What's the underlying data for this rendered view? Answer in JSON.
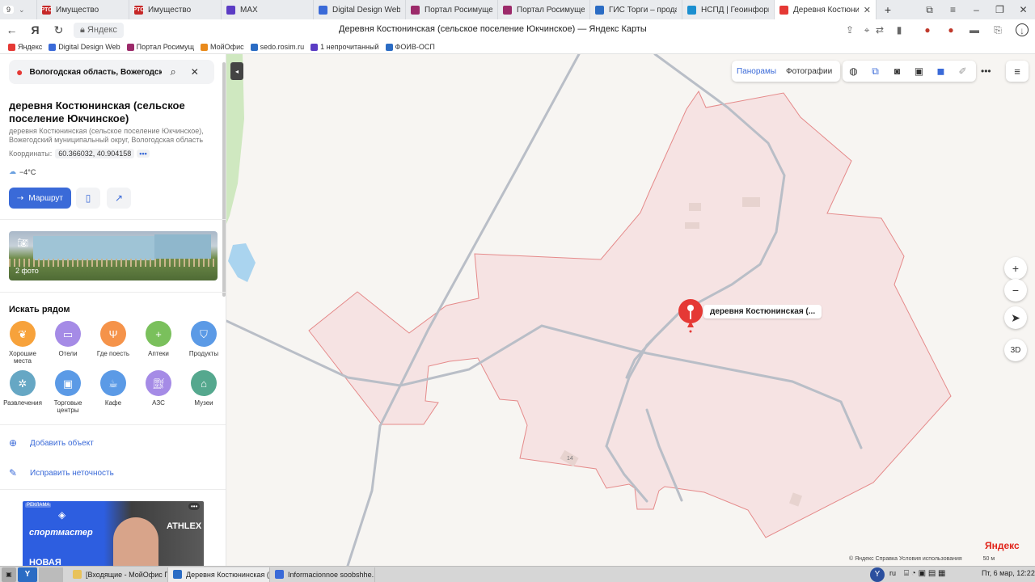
{
  "browser": {
    "tab_counter": "9",
    "tabs": [
      {
        "label": "Имущество",
        "favicon": "РТС",
        "color": "#c62828"
      },
      {
        "label": "Имущество",
        "favicon": "РТС",
        "color": "#c62828"
      },
      {
        "label": "MAX",
        "favicon": "",
        "color": "#5b3cc4"
      },
      {
        "label": "Digital Design Web C",
        "favicon": "",
        "color": "#3a6ad8"
      },
      {
        "label": "Портал Росимущест",
        "favicon": "",
        "color": "#9c2a6a"
      },
      {
        "label": "Портал Росимущест",
        "favicon": "",
        "color": "#9c2a6a"
      },
      {
        "label": "ГИС Торги – продаж",
        "favicon": "",
        "color": "#2b6cc4"
      },
      {
        "label": "НСПД | Геоинформа",
        "favicon": "",
        "color": "#1b8fd0"
      },
      {
        "label": "Деревня Костюни",
        "favicon": "",
        "color": "#e53935"
      }
    ],
    "address_site": "Яндекс",
    "page_title": "Деревня Костюнинская (сельское поселение Юкчинское) — Яндекс Карты",
    "bookmarks": [
      {
        "label": "Яндекс",
        "color": "#e53935"
      },
      {
        "label": "Digital Design Web",
        "color": "#3a6ad8"
      },
      {
        "label": "Портал Росимущ",
        "color": "#9c2a6a"
      },
      {
        "label": "МойОфис",
        "color": "#e98a1b"
      },
      {
        "label": "sedo.rosim.ru",
        "color": "#2b6cc4"
      },
      {
        "label": "1 непрочитанный",
        "color": "#5b3cc4"
      },
      {
        "label": "ФОИВ-ОСП",
        "color": "#2b6cc4"
      }
    ]
  },
  "sidebar": {
    "search_value": "Вологодская область, Вожегодский",
    "place_title": "деревня Костюнинская (сельское поселение Юкчинское)",
    "place_address": "деревня Костюнинская (сельское поселение Юкчинское), Вожегодский муниципальный округ, Вологодская область",
    "coords_label": "Координаты:",
    "coords_value": "60.366032, 40.904158",
    "coords_more": "•••",
    "weather": "−4°C",
    "route_label": "Маршрут",
    "photo_count": "2 фото",
    "nearby_title": "Искать рядом",
    "categories": [
      {
        "label": "Хорошие места",
        "color": "#f7a23b",
        "icon": "laurel-pin-icon"
      },
      {
        "label": "Отели",
        "color": "#a58be6",
        "icon": "bed-icon"
      },
      {
        "label": "Где поесть",
        "color": "#f5934a",
        "icon": "fork-knife-icon"
      },
      {
        "label": "Аптеки",
        "color": "#7ac05c",
        "icon": "plus-icon"
      },
      {
        "label": "Продукты",
        "color": "#5b9ae6",
        "icon": "basket-icon"
      },
      {
        "label": "Развлечения",
        "color": "#66a7c4",
        "icon": "wheel-icon"
      },
      {
        "label": "Торговые центры",
        "color": "#5b9ae6",
        "icon": "bag-icon"
      },
      {
        "label": "Кафе",
        "color": "#5b9ae6",
        "icon": "cup-icon"
      },
      {
        "label": "АЗС",
        "color": "#a58be6",
        "icon": "fuel-icon"
      },
      {
        "label": "Музеи",
        "color": "#55a88e",
        "icon": "museum-icon"
      }
    ],
    "add_object": "Добавить объект",
    "fix_error": "Исправить неточность",
    "ad": {
      "label": "РЕКЛАМА",
      "brand": "спортмастер",
      "partner": "ATHLEX",
      "headline": "НОВАЯ"
    }
  },
  "map": {
    "toolbar": {
      "panoramas": "Панорамы",
      "photos": "Фотографии"
    },
    "pin_label": "деревня Костюнинская (...",
    "house_number": "14",
    "logo": "Яндекс",
    "footer": "© Яндекс   Справка   Условия использования",
    "scale": "50 м",
    "btn_3d": "3D",
    "colors": {
      "area_fill": "#f6dfe0",
      "area_stroke": "#e58a8a",
      "pin": "#e53935",
      "road": "#b9bec7",
      "water": "#aad4ef",
      "forest": "#cfe8c0"
    }
  },
  "taskbar": {
    "items": [
      {
        "label": "[Входящие - МойОфис П...",
        "color": "#e8c25a"
      },
      {
        "label": "Деревня Костюнинская (...",
        "color": "#2b6cc4"
      },
      {
        "label": "Informacionnoe soobshhe...",
        "color": "#3a6ad8"
      }
    ],
    "lang": "ru",
    "clock": "Пт, 6 мар, 12:22"
  }
}
